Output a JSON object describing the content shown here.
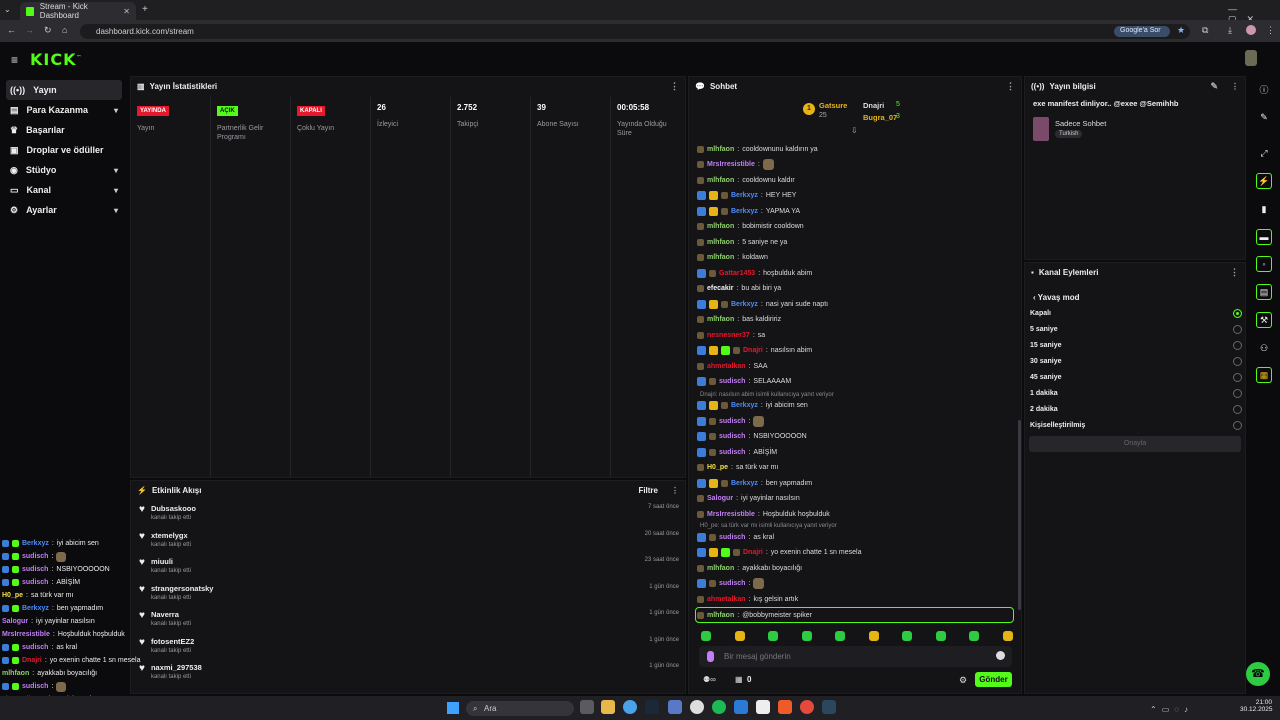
{
  "browser": {
    "tab_title": "Stream - Kick Dashboard",
    "url": "dashboard.kick.com/stream",
    "google_button": "Google'a Sor"
  },
  "app": {
    "logo": "KICK",
    "logo_tm": "™"
  },
  "sidebar": {
    "items": [
      {
        "label": "Yayın"
      },
      {
        "label": "Para Kazanma"
      },
      {
        "label": "Başarılar"
      },
      {
        "label": "Droplar ve ödüller"
      },
      {
        "label": "Stüdyo"
      },
      {
        "label": "Kanal"
      },
      {
        "label": "Ayarlar"
      }
    ]
  },
  "stats": {
    "title": "Yayın İstatistikleri",
    "columns": [
      {
        "badge": "YAYINDA",
        "badge_color": "#e5182d",
        "label": "Yayın"
      },
      {
        "badge": "AÇIK",
        "badge_color": "#53fc18",
        "label": "Partnerlik Gelir Programı"
      },
      {
        "badge": "KAPALI",
        "badge_color": "#e5182d",
        "label": "Çoklu Yayın"
      },
      {
        "value": "26",
        "label": "İzleyici"
      },
      {
        "value": "2.752",
        "label": "Takipçi"
      },
      {
        "value": "39",
        "label": "Abone Sayısı"
      },
      {
        "value": "00:05:58",
        "label": "Yayında Olduğu Süre"
      }
    ]
  },
  "activity": {
    "title": "Etkinlik Akışı",
    "filter": "Filtre",
    "items": [
      {
        "name": "Dubsaskooo",
        "sub": "kanalı takip etti",
        "time": "7 saat önce"
      },
      {
        "name": "xtemelygx",
        "sub": "kanalı takip etti",
        "time": "20 saat önce"
      },
      {
        "name": "miuuli",
        "sub": "kanalı takip etti",
        "time": "23 saat önce"
      },
      {
        "name": "strangersonatsky",
        "sub": "kanalı takip etti",
        "time": "1 gün önce"
      },
      {
        "name": "Naverra",
        "sub": "kanalı takip etti",
        "time": "1 gün önce"
      },
      {
        "name": "fotosentEZ2",
        "sub": "kanalı takip etti",
        "time": "1 gün önce"
      },
      {
        "name": "naxmi_297538",
        "sub": "kanalı takip etti",
        "time": "1 gün önce"
      }
    ]
  },
  "chat": {
    "title": "Sohbet",
    "leaderboard": [
      {
        "name": "Gatsure",
        "count": "25"
      },
      {
        "name": "Dnajri",
        "count": "5"
      },
      {
        "name": "Bugra_07",
        "count": "3"
      }
    ],
    "messages": [
      {
        "user": "mlhfaon",
        "color": "#8fd16a",
        "text": "cooldownunu kaldırın ya"
      },
      {
        "user": "MrsIrresistible",
        "color": "#c27ff5",
        "text": ""
      },
      {
        "user": "mlhfaon",
        "color": "#8fd16a",
        "text": "cooldownu kaldır"
      },
      {
        "user": "Berkxyz",
        "color": "#4f8cf7",
        "text": "HEY HEY"
      },
      {
        "user": "Berkxyz",
        "color": "#4f8cf7",
        "text": "YAPMA YA"
      },
      {
        "user": "mlhfaon",
        "color": "#8fd16a",
        "text": "bobimistir cooldown"
      },
      {
        "user": "mlhfaon",
        "color": "#8fd16a",
        "text": "5 saniye ne ya"
      },
      {
        "user": "mlhfaon",
        "color": "#8fd16a",
        "text": "koldawn"
      },
      {
        "user": "Gattar1453",
        "color": "#e5182d",
        "text": "hoşbulduk abim"
      },
      {
        "user": "efecakir",
        "color": "#f2f2f2",
        "text": "bu abi biri ya"
      },
      {
        "user": "Berkxyz",
        "color": "#4f8cf7",
        "text": "nasi yani sude naptı"
      },
      {
        "user": "mlhfaon",
        "color": "#8fd16a",
        "text": "bas kaldiririz"
      },
      {
        "user": "nesnesner37",
        "color": "#e5182d",
        "text": "sa"
      },
      {
        "user": "Dnajri",
        "color": "#e5182d",
        "text": "nasılsın abim"
      },
      {
        "user": "ahmetalkan",
        "color": "#e5182d",
        "text": "SAA"
      },
      {
        "user": "sudisch",
        "color": "#c27ff5",
        "text": "SELAAAAM"
      },
      {
        "user": "Berkxyz",
        "color": "#4f8cf7",
        "text": "iyi abicim sen"
      },
      {
        "user": "sudisch",
        "color": "#c27ff5",
        "text": ""
      },
      {
        "user": "sudisch",
        "color": "#c27ff5",
        "text": "NSBIYOOOOON"
      },
      {
        "user": "sudisch",
        "color": "#c27ff5",
        "text": "ABİŞİM"
      },
      {
        "user": "H0_pe",
        "color": "#f2e04b",
        "text": "sa türk var mı"
      },
      {
        "user": "Berkxyz",
        "color": "#4f8cf7",
        "text": "ben yapmadım"
      },
      {
        "user": "Salogur",
        "color": "#c27ff5",
        "text": "iyi yayinlar nasılsın"
      },
      {
        "user": "MrsIrresistible",
        "color": "#c27ff5",
        "text": "Hoşbulduk hoşbulduk"
      },
      {
        "user": "sudisch",
        "color": "#c27ff5",
        "text": "as kral"
      },
      {
        "user": "Dnajri",
        "color": "#e5182d",
        "text": "yo exenin chatte 1 sn mesela"
      },
      {
        "user": "mlhfaon",
        "color": "#8fd16a",
        "text": "ayakkabı boyacılığı"
      },
      {
        "user": "sudisch",
        "color": "#c27ff5",
        "text": ""
      },
      {
        "user": "ahmetalkan",
        "color": "#e5182d",
        "text": "kış gelsin artık"
      },
      {
        "user": "mlhfaon",
        "color": "#8fd16a",
        "text": "@bobbymeister spiker"
      }
    ],
    "replies": [
      "Dnajri: nasılsın abim isimli kullanıcıya yanıt veriyor",
      "H0_pe: sa türk var mı isimli kullanıcıya yanıt veriyor"
    ],
    "input_placeholder": "Bir mesaj gönderin",
    "send_label": "Gönder",
    "footer_count": "0"
  },
  "stream_info": {
    "title": "Yayın bilgisi",
    "stream_title": "exe manifest dinliyor.. @exee @Semihhb",
    "category": "Sadece Sohbet",
    "language": "Turkish"
  },
  "channel_actions": {
    "title": "Kanal Eylemleri",
    "slow_mode": "Yavaş mod",
    "options": [
      "Kapalı",
      "5 saniye",
      "15 saniye",
      "30 saniye",
      "45 saniye",
      "1 dakika",
      "2 dakika",
      "Kişiselleştirilmiş"
    ],
    "selected": 0,
    "confirm": "Onayla"
  },
  "overlay": {
    "messages": [
      {
        "user": "Berkxyz",
        "color": "#4f8cf7",
        "text": "iyi abicim sen"
      },
      {
        "user": "sudisch",
        "color": "#c27ff5",
        "text": ""
      },
      {
        "user": "sudisch",
        "color": "#c27ff5",
        "text": "NSBIYOOOOON"
      },
      {
        "user": "sudisch",
        "color": "#c27ff5",
        "text": "ABİŞİM"
      },
      {
        "user": "H0_pe",
        "color": "#f2e04b",
        "text": "sa türk var mı"
      },
      {
        "user": "Berkxyz",
        "color": "#4f8cf7",
        "text": "ben yapmadım"
      },
      {
        "user": "Salogur",
        "color": "#c27ff5",
        "text": "iyi yayinlar nasılsın"
      },
      {
        "user": "MrsIrresistible",
        "color": "#c27ff5",
        "text": "Hoşbulduk hoşbulduk"
      },
      {
        "user": "sudisch",
        "color": "#c27ff5",
        "text": "as kral"
      },
      {
        "user": "Dnajri",
        "color": "#e5182d",
        "text": "yo exenin chatte 1 sn mesela"
      },
      {
        "user": "mlhfaon",
        "color": "#8fd16a",
        "text": "ayakkabı boyacılığı"
      },
      {
        "user": "sudisch",
        "color": "#c27ff5",
        "text": ""
      },
      {
        "user": "ahmetalkan",
        "color": "#e5182d",
        "text": "kış gelsin artık"
      },
      {
        "user": "mlhfaon",
        "color": "#8fd16a",
        "text": "@bobbymeister spiker"
      }
    ]
  },
  "taskbar": {
    "search": "Ara",
    "time": "21:00",
    "date": "30.12.2025"
  },
  "colors": {
    "accent": "#53fc18",
    "live": "#e5182d"
  }
}
